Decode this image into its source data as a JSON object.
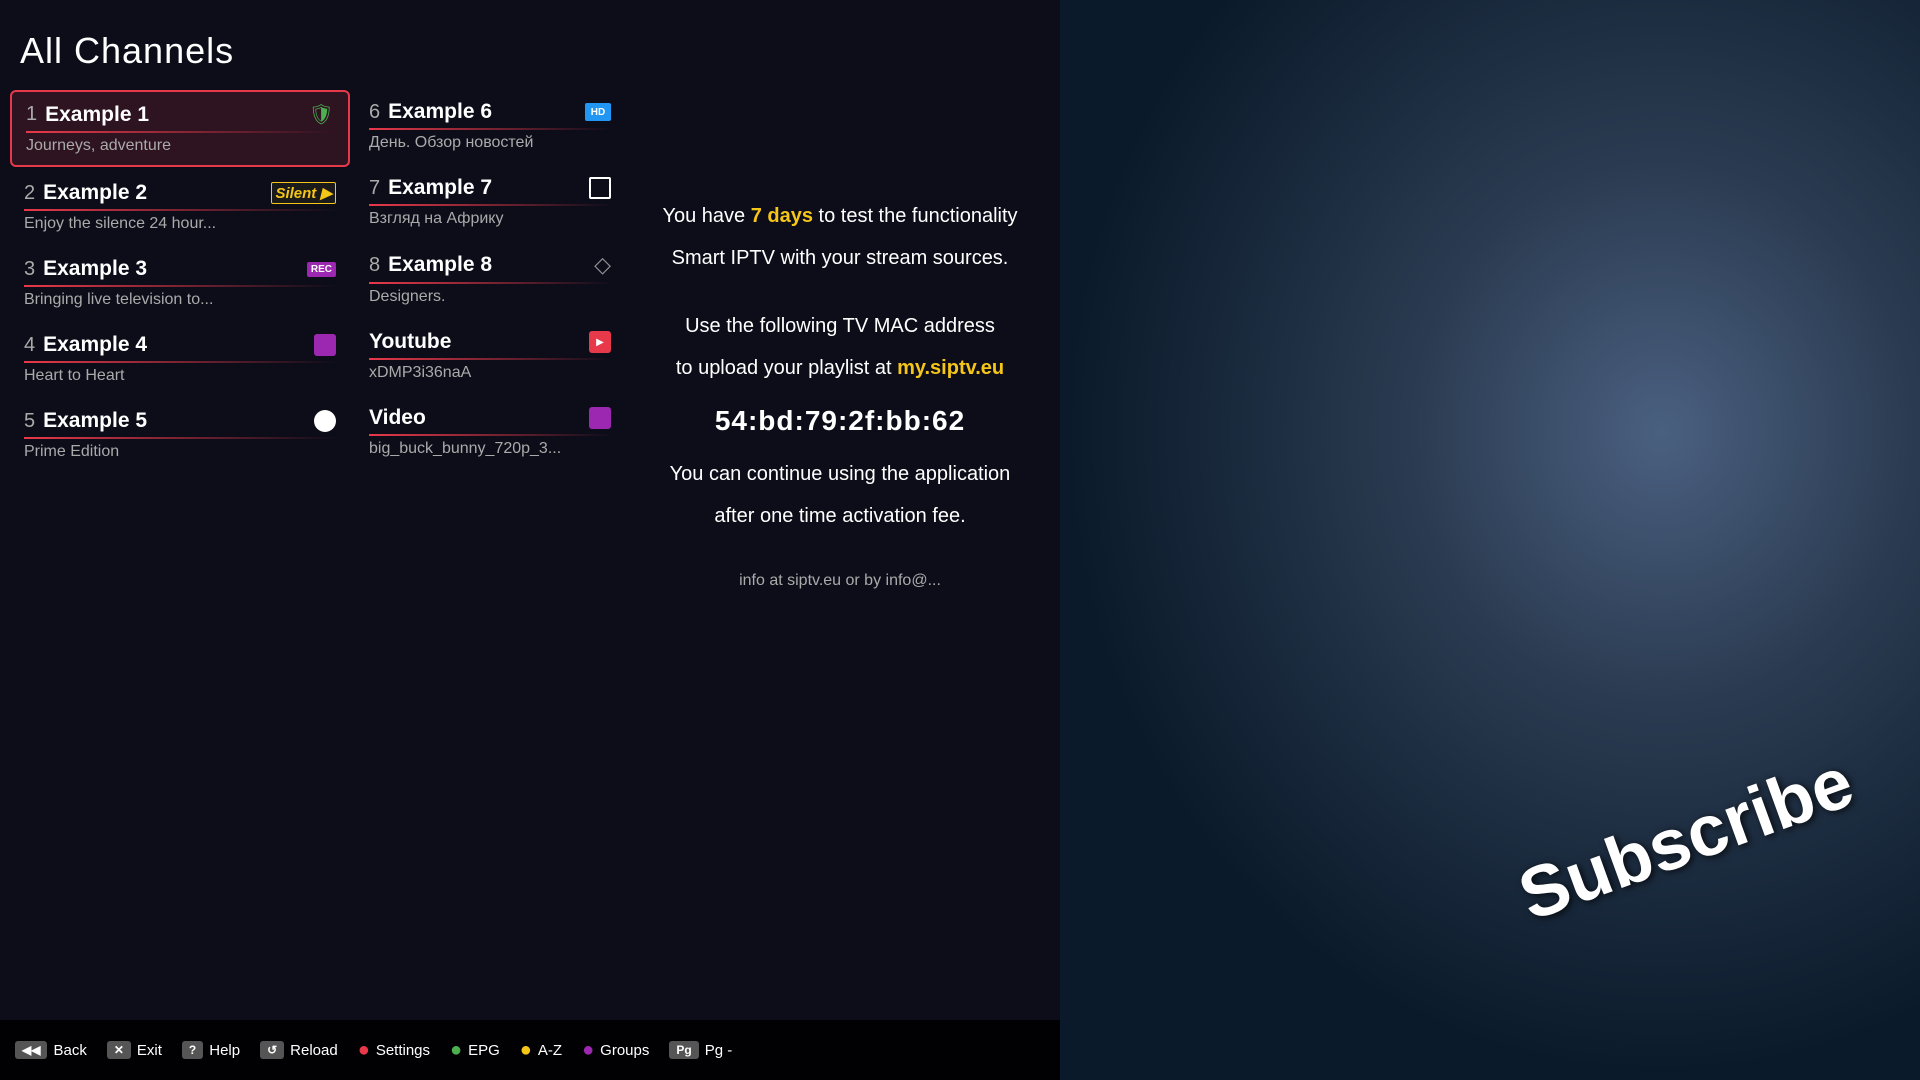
{
  "page_title": "All Channels",
  "left_channels": [
    {
      "number": "1",
      "name": "Example 1",
      "desc": "Journeys, adventure",
      "selected": true,
      "icon_type": "green_shield"
    },
    {
      "number": "2",
      "name": "Example 2",
      "desc": "Enjoy the silence 24 hour...",
      "selected": false,
      "icon_type": "silent"
    },
    {
      "number": "3",
      "name": "Example 3",
      "desc": "Bringing live television to...",
      "selected": false,
      "icon_type": "rec"
    },
    {
      "number": "4",
      "name": "Example 4",
      "desc": "Heart to Heart",
      "selected": false,
      "icon_type": "purple"
    },
    {
      "number": "5",
      "name": "Example 5",
      "desc": "Prime Edition",
      "selected": false,
      "icon_type": "circle"
    }
  ],
  "right_channels": [
    {
      "number": "6",
      "name": "Example 6",
      "desc": "День. Обзор новостей",
      "icon_type": "tv"
    },
    {
      "number": "7",
      "name": "Example 7",
      "desc": "Взгляд на Африку",
      "icon_type": "white_square"
    },
    {
      "number": "8",
      "name": "Example 8",
      "desc": "Designers.",
      "icon_type": "diamond"
    },
    {
      "number": "",
      "name": "Youtube",
      "desc": "xDMP3i36naA",
      "icon_type": "red_square"
    },
    {
      "number": "",
      "name": "Video",
      "desc": "big_buck_bunny_720p_3...",
      "icon_type": "purple_square"
    }
  ],
  "info_panel": {
    "line1": "You have ",
    "highlight_days": "7 days",
    "line1_end": " to test the functionality",
    "line2": "Smart IPTV with your stream sources.",
    "line3": "Use the following TV MAC address",
    "line4": "to upload your playlist at ",
    "highlight_link": "my.siptv.eu",
    "mac": "54:bd:79:2f:bb:62",
    "line5": "You can continue using the application",
    "line6": "after one time activation fee.",
    "line7": "info at siptv.eu or by info@..."
  },
  "bottom_bar": [
    {
      "badge": "Back",
      "badge_color": "gray",
      "label": "Back"
    },
    {
      "badge": "Exit",
      "badge_color": "gray",
      "label": "Exit"
    },
    {
      "badge": "Help",
      "badge_color": "gray",
      "label": "Help"
    },
    {
      "badge": "Reload",
      "badge_color": "gray",
      "label": "Reload"
    },
    {
      "badge": "●",
      "badge_color": "red",
      "label": "Settings"
    },
    {
      "badge": "●",
      "badge_color": "green",
      "label": "EPG"
    },
    {
      "badge": "●",
      "badge_color": "yellow",
      "label": "A-Z"
    },
    {
      "badge": "●",
      "badge_color": "purple",
      "label": "Groups"
    },
    {
      "badge": "Pg -",
      "badge_color": "gray",
      "label": "Pg -"
    }
  ],
  "subscribe_text": "Subscribe"
}
